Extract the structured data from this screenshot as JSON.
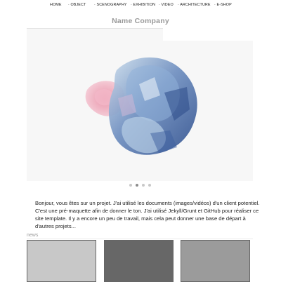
{
  "nav": {
    "items": [
      "HOME",
      "· OBJECT",
      "· SCENOGRAPHY",
      "· EXHIBITION",
      "· VIDEO",
      "· ARCHITECTURE",
      "· E-SHOP"
    ]
  },
  "brand": {
    "name": "Name Company"
  },
  "carousel": {
    "image": "crumpled-glass-sculpture",
    "slide_count": 4,
    "active_slide": 2
  },
  "intro": {
    "text": "Bonjour, vous êtes sur un projet. J'ai utilisé les documents (images/vidéos) d'un client potentiel. C'est une pré-maquette afin de donner le ton. J'ai utilisé Jekyll/Grunt et GitHub pour réaliser ce site template. Il y a encore un peu de travail, mais cela peut donner une base de départ à d'autres projets..."
  },
  "news": {
    "label": "news",
    "cards": [
      {
        "color": "#c8c8c8"
      },
      {
        "color": "#676767"
      },
      {
        "color": "#9b9b9b"
      }
    ]
  }
}
